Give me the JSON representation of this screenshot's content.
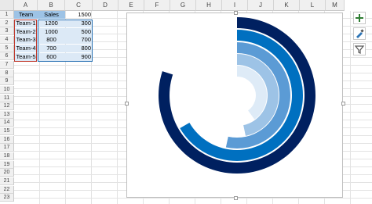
{
  "columns": [
    "A",
    "B",
    "C",
    "D",
    "E",
    "F",
    "G",
    "H",
    "I",
    "J",
    "K",
    "L",
    "M"
  ],
  "rows": [
    "1",
    "2",
    "3",
    "4",
    "5",
    "6",
    "7",
    "8",
    "9",
    "10",
    "11",
    "12",
    "13",
    "14",
    "15",
    "16",
    "17",
    "18",
    "19",
    "20",
    "21",
    "22",
    "23"
  ],
  "table": {
    "header": {
      "team": "Team",
      "sales": "Sales",
      "max": "1500"
    },
    "data": [
      {
        "team": "Team-1",
        "sales": "1200",
        "c": "300"
      },
      {
        "team": "Team-2",
        "sales": "1000",
        "c": "500"
      },
      {
        "team": "Team-3",
        "sales": "800",
        "c": "700"
      },
      {
        "team": "Team-4",
        "sales": "700",
        "c": "800"
      },
      {
        "team": "Team-5",
        "sales": "600",
        "c": "900"
      }
    ]
  },
  "chart_data": {
    "type": "radial-bar",
    "max": 1500,
    "categories": [
      "Team-1",
      "Team-2",
      "Team-3",
      "Team-4",
      "Team-5"
    ],
    "values": [
      1200,
      1000,
      800,
      700,
      600
    ],
    "colors": [
      "#002060",
      "#0070c0",
      "#5b9bd5",
      "#9dc3e6",
      "#deebf7"
    ]
  },
  "tools": [
    {
      "name": "chart-elements-icon"
    },
    {
      "name": "chart-styles-icon"
    },
    {
      "name": "chart-filters-icon"
    }
  ]
}
